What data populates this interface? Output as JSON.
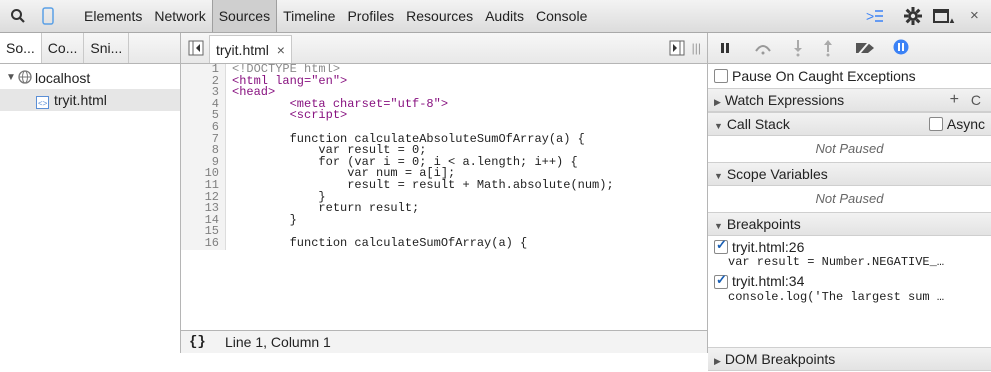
{
  "toolbar": {
    "tabs": [
      "Elements",
      "Network",
      "Sources",
      "Timeline",
      "Profiles",
      "Resources",
      "Audits",
      "Console"
    ],
    "active_tab": "Sources",
    "icons": [
      "search-icon",
      "device-icon",
      "console-drawer-icon",
      "gear-icon",
      "dock-icon",
      "close-icon"
    ],
    "close_glyph": "×"
  },
  "navigator": {
    "tabs": [
      "So...",
      "Co...",
      "Sni..."
    ],
    "tree": [
      {
        "label": "localhost",
        "level": 0,
        "expanded": true
      },
      {
        "label": "tryit.html",
        "level": 1,
        "selected": true
      }
    ]
  },
  "editor": {
    "file_tab": "tryit.html",
    "file_tab_close": "×",
    "lines": [
      {
        "n": "1",
        "text": "<!DOCTYPE html>"
      },
      {
        "n": "2",
        "text": "<html lang=\"en\">"
      },
      {
        "n": "3",
        "text": "<head>"
      },
      {
        "n": "4",
        "text": "        <meta charset=\"utf-8\">"
      },
      {
        "n": "5",
        "text": "        <script>"
      },
      {
        "n": "6",
        "text": ""
      },
      {
        "n": "7",
        "text": "        function calculateAbsoluteSumOfArray(a) {"
      },
      {
        "n": "8",
        "text": "            var result = 0;"
      },
      {
        "n": "9",
        "text": "            for (var i = 0; i < a.length; i++) {"
      },
      {
        "n": "10",
        "text": "                var num = a[i];"
      },
      {
        "n": "11",
        "text": "                result = result + Math.absolute(num);"
      },
      {
        "n": "12",
        "text": "            }"
      },
      {
        "n": "13",
        "text": "            return result;"
      },
      {
        "n": "14",
        "text": "        }"
      },
      {
        "n": "15",
        "text": ""
      },
      {
        "n": "16",
        "text": "        function calculateSumOfArray(a) {"
      }
    ],
    "status": {
      "pretty_print": "{}",
      "position": "Line 1, Column 1"
    }
  },
  "debugger": {
    "pause_on_caught": "Pause On Caught Exceptions",
    "sections": {
      "watch": "Watch Expressions",
      "call_stack": "Call Stack",
      "async": "Async",
      "scope": "Scope Variables",
      "breakpoints": "Breakpoints",
      "dom_breakpoints": "DOM Breakpoints"
    },
    "not_paused": "Not Paused",
    "watch_add": "+",
    "watch_refresh": "C",
    "breakpoints": [
      {
        "location": "tryit.html:26",
        "code": "var result = Number.NEGATIVE_…"
      },
      {
        "location": "tryit.html:34",
        "code": "console.log('The largest sum …"
      }
    ]
  },
  "colors": {
    "accent_blue": "#1a73e8",
    "tab_active_bg": "#cfcfcf"
  }
}
